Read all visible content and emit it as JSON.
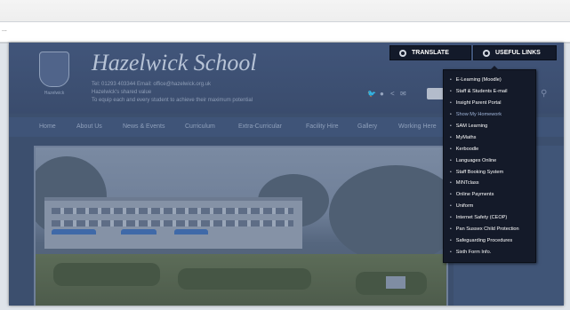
{
  "browser": {
    "address_text": "..."
  },
  "site": {
    "name": "Hazelwick School",
    "contact_line1": "Tel: 01293 403344   Email: office@hazelwick.org.uk",
    "contact_line2": "Hazelwick's shared value",
    "contact_line3": "To equip each and every student to achieve their maximum potential",
    "crest_caption": "Hazelwick",
    "nav": [
      "Home",
      "About Us",
      "News & Events",
      "Curriculum",
      "Extra-Curricular",
      "Facility Hire",
      "Gallery",
      "Working Here"
    ]
  },
  "buttons": {
    "translate": "TRANSLATE",
    "useful_links": "USEFUL LINKS"
  },
  "useful_links": [
    "E-Learning (Moodle)",
    "Staff & Students E-mail",
    "Insight Parent Portal",
    "Show My Homework",
    "SAM Learning",
    "MyMaths",
    "Kerboodle",
    "Languages Online",
    "Staff Booking System",
    "MINTclass",
    "Online Payments",
    "Uniform",
    "Internet Safety (CEOP)",
    "Pan Sussex Child Protection",
    "Safeguarding Procedures",
    "Sixth Form Info."
  ],
  "colors": {
    "overlay": "#3c4f6e",
    "dropdown_bg": "#141a29",
    "accent_link": "#9fb4d8"
  }
}
